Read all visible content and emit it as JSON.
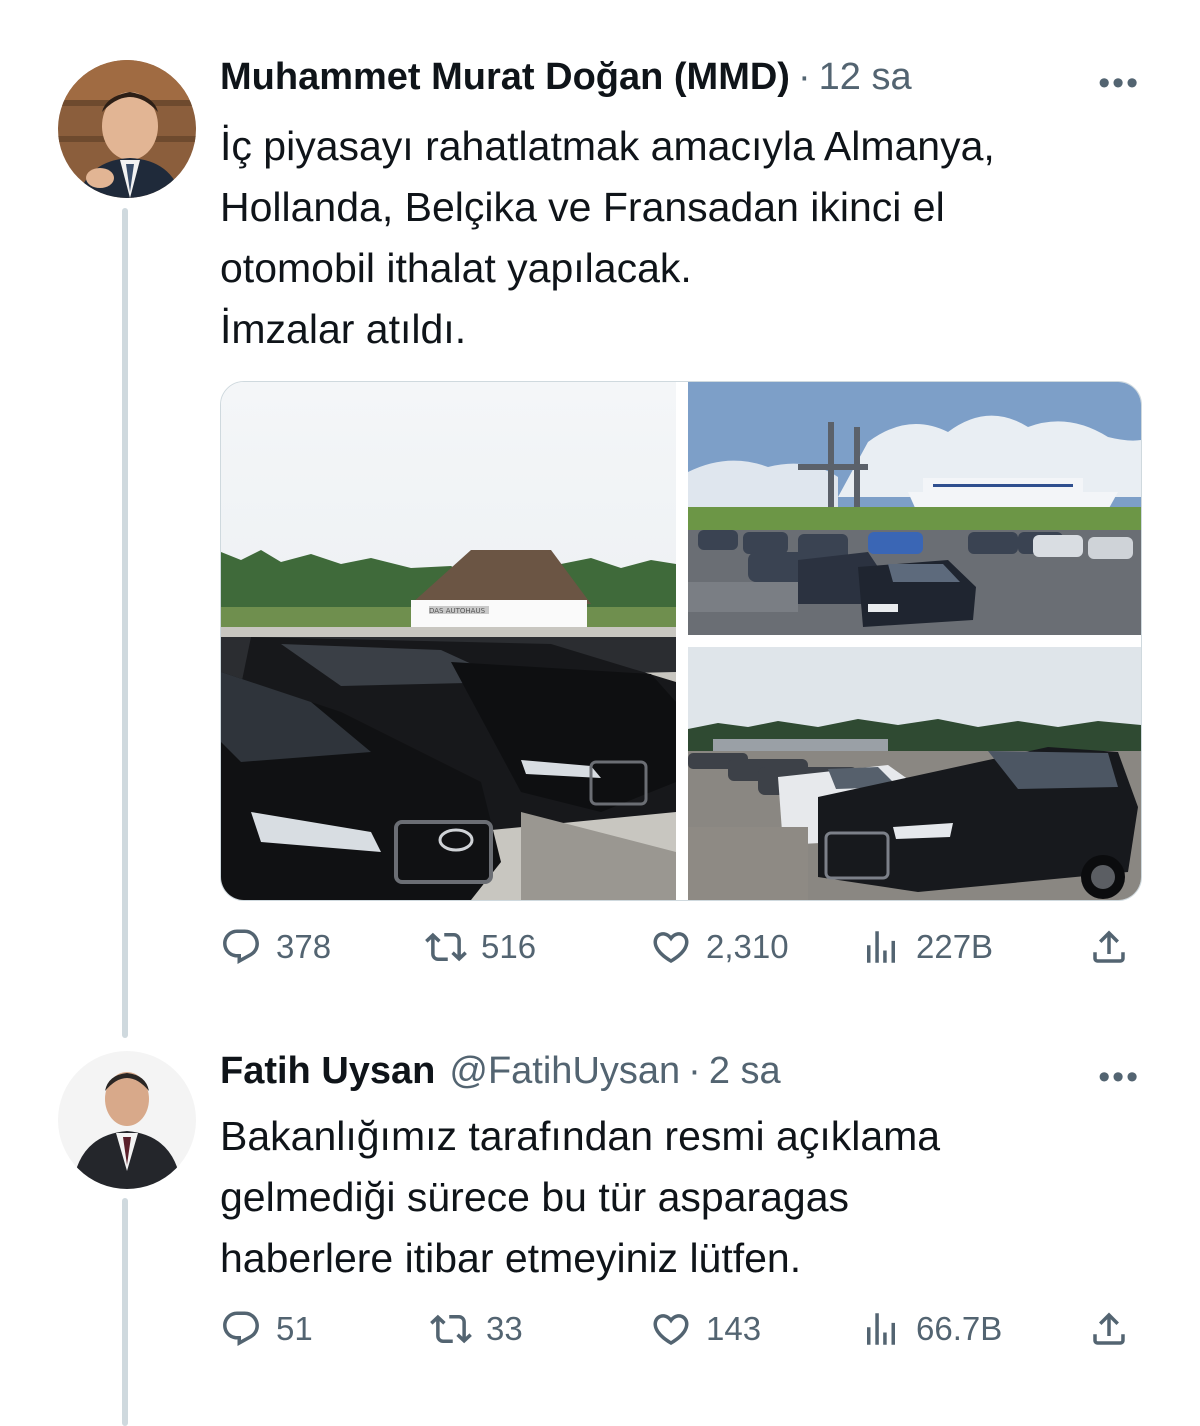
{
  "tweets": [
    {
      "author": "Muhammet Murat Doğan (MMD)",
      "time": "12 sa",
      "text_lines": [
        "İç piyasayı rahatlatmak amacıyla Almanya,",
        "Hollanda, Belçika ve Fransadan ikinci el",
        "otomobil ithalat yapılacak.",
        "İmzalar atıldı."
      ],
      "media_sign": "DAS AUTOHAUS",
      "stats": {
        "replies": "378",
        "retweets": "516",
        "likes": "2,310",
        "views": "227B"
      }
    },
    {
      "author": "Fatih Uysan",
      "handle": "@FatihUysan",
      "time": "2 sa",
      "text_lines": [
        "Bakanlığımız tarafından resmi açıklama",
        "gelmediği sürece bu tür asparagas",
        "haberlere itibar etmeyiniz lütfen."
      ],
      "stats": {
        "replies": "51",
        "retweets": "33",
        "likes": "143",
        "views": "66.7B"
      }
    }
  ],
  "ui": {
    "dot": "·",
    "more": "•••"
  },
  "icons": [
    "reply-icon",
    "retweet-icon",
    "like-icon",
    "views-icon",
    "share-icon",
    "more-icon"
  ],
  "colors": {
    "text": "#0f1419",
    "secondary": "#536471",
    "thread_line": "#cfd9de"
  }
}
